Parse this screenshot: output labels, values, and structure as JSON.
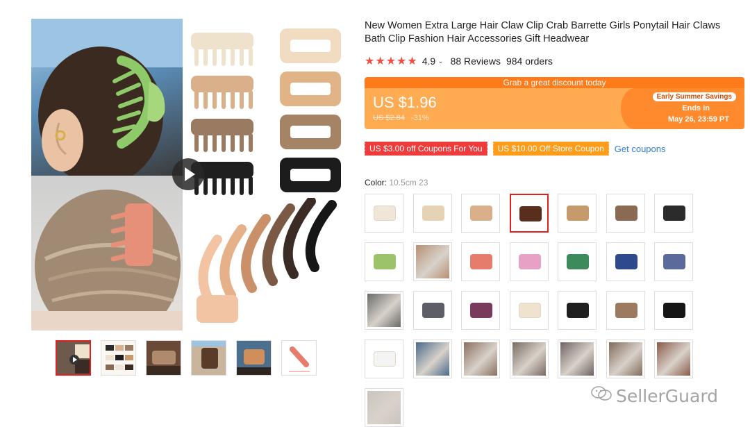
{
  "product": {
    "title": "New Women Extra Large Hair Claw Clip Crab Barrette Girls Ponytail Hair Claws Bath Clip Fashion Hair Accessories Gift Headwear",
    "rating": {
      "stars": "★★★★★",
      "score": "4.9",
      "caret": "⌄",
      "reviews": "88 Reviews",
      "orders": "984 orders"
    }
  },
  "price": {
    "banner": "Grab a great discount today",
    "current": "US $1.96",
    "original": "US $2.84",
    "discount": "-31%",
    "promo_tag": "Early Summer Savings",
    "promo_ends": "Ends in",
    "promo_date": "May 26, 23:59 PT",
    "colors": {
      "banner": "#ff7a1a",
      "box": "#ffab52",
      "wedge": "#ff8a2e"
    }
  },
  "coupons": {
    "items": [
      {
        "label": "US $3.00 off Coupons For You",
        "color": "#ee3b3b"
      },
      {
        "label": "US $10.00 Off Store Coupon",
        "color": "#ff9c1a"
      }
    ],
    "get_label": "Get coupons"
  },
  "color": {
    "label": "Color:",
    "selected_value": "10.5cm 23",
    "swatches": [
      {
        "icon": "claw-clip-cream",
        "tone": "#efe6d8",
        "selected": false
      },
      {
        "icon": "claw-clip-multi",
        "tone": "#e6d2b5",
        "selected": false
      },
      {
        "icon": "claw-clip-tan",
        "tone": "#d9b08a",
        "selected": false
      },
      {
        "icon": "claw-clip-tortoise",
        "tone": "#5a2e1c",
        "selected": true
      },
      {
        "icon": "claw-clip-caramel",
        "tone": "#c69a6b",
        "selected": false
      },
      {
        "icon": "claw-clip-mocha",
        "tone": "#8a6a52",
        "selected": false
      },
      {
        "icon": "claw-clip-black",
        "tone": "#2b2b2b",
        "selected": false
      },
      {
        "icon": "claw-clip-green",
        "tone": "#9cc36a",
        "selected": false
      },
      {
        "icon": "photo-pastel-set",
        "tone": "#b78f73",
        "selected": false
      },
      {
        "icon": "claw-clip-coral",
        "tone": "#e57c6c",
        "selected": false
      },
      {
        "icon": "claw-clip-pink",
        "tone": "#e6a1c4",
        "selected": false
      },
      {
        "icon": "claw-clip-emerald",
        "tone": "#3d8a5c",
        "selected": false
      },
      {
        "icon": "claw-clip-navy",
        "tone": "#2f4a8c",
        "selected": false
      },
      {
        "icon": "claw-clip-slate",
        "tone": "#5a6a9a",
        "selected": false
      },
      {
        "icon": "photo-black-clip",
        "tone": "#6a6a6a",
        "selected": false
      },
      {
        "icon": "claw-clip-grey",
        "tone": "#5e5e66",
        "selected": false
      },
      {
        "icon": "claw-clip-plum",
        "tone": "#7a3a5c",
        "selected": false
      },
      {
        "icon": "claw-clip-ivory",
        "tone": "#efe3cf",
        "selected": false
      },
      {
        "icon": "claw-clip-black-rect",
        "tone": "#1f1f1f",
        "selected": false
      },
      {
        "icon": "claw-clip-brown-rect",
        "tone": "#9c7a5f",
        "selected": false
      },
      {
        "icon": "claw-clip-black-open",
        "tone": "#151515",
        "selected": false
      },
      {
        "icon": "claw-clip-white",
        "tone": "#f4f4f4",
        "selected": false
      },
      {
        "icon": "photo-blue-brown",
        "tone": "#4a6a8a",
        "selected": false
      },
      {
        "icon": "photo-mixed-1",
        "tone": "#8a7060",
        "selected": false
      },
      {
        "icon": "photo-mixed-2",
        "tone": "#7a6a62",
        "selected": false
      },
      {
        "icon": "photo-mixed-3",
        "tone": "#6e6262",
        "selected": false
      },
      {
        "icon": "photo-mixed-4",
        "tone": "#826a5a",
        "selected": false
      },
      {
        "icon": "claw-clip-brown-photo",
        "tone": "#8a5a4a",
        "selected": false
      },
      {
        "icon": "photo-hand-clip",
        "tone": "#c9c4be",
        "selected": false
      }
    ]
  },
  "gallery": {
    "thumbnails": [
      {
        "icon": "thumb-main",
        "active": true
      },
      {
        "icon": "thumb-colors",
        "active": false
      },
      {
        "icon": "thumb-hair-1",
        "active": false
      },
      {
        "icon": "thumb-hair-2",
        "active": false
      },
      {
        "icon": "thumb-hair-3",
        "active": false
      },
      {
        "icon": "thumb-size",
        "active": false
      }
    ]
  },
  "watermark": {
    "text": "SellerGuard"
  }
}
